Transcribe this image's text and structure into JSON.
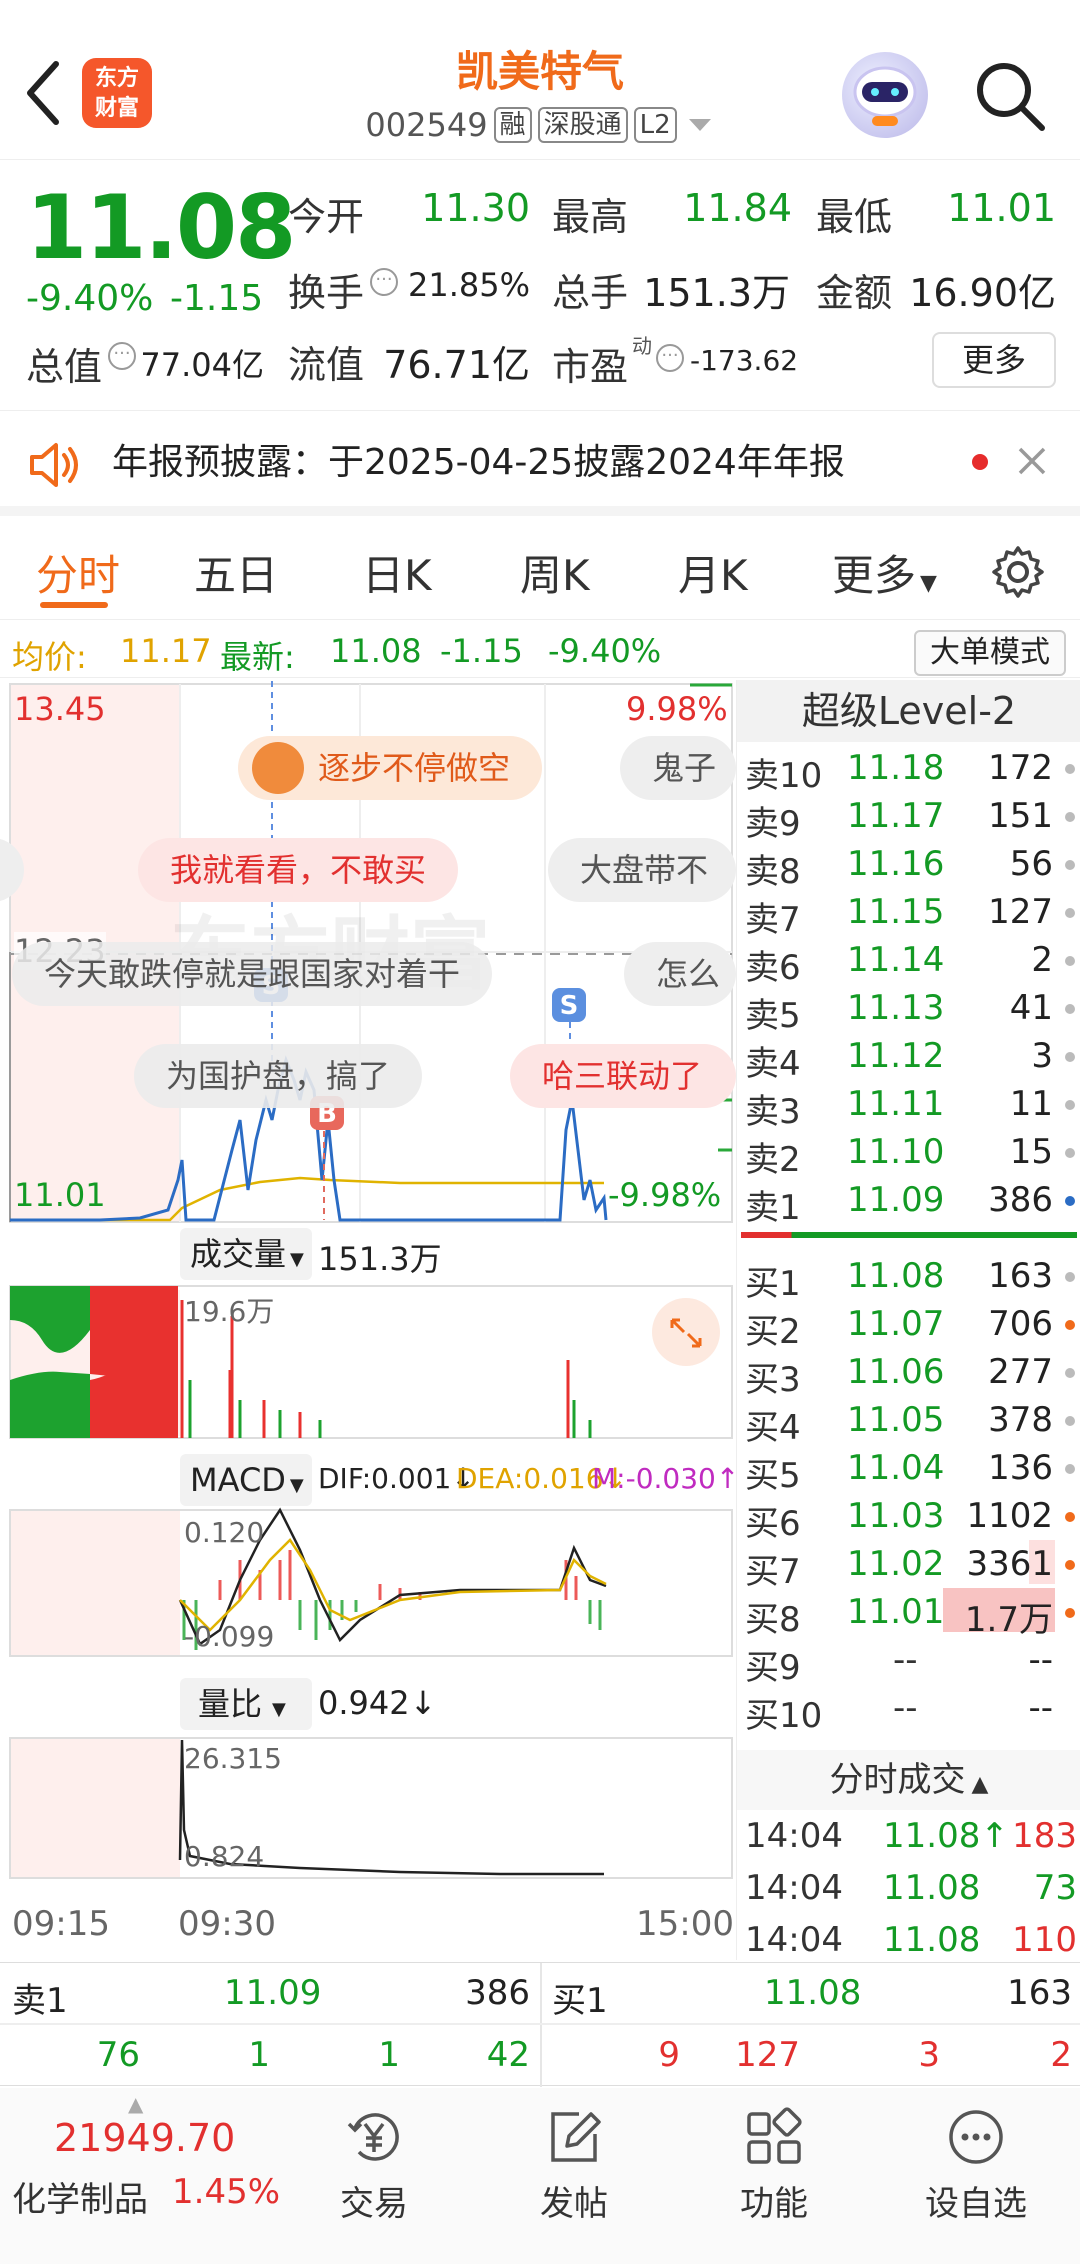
{
  "header": {
    "logo_line1": "东方",
    "logo_line2": "财富",
    "stock_name": "凯美特气",
    "stock_code": "002549",
    "tag_rong": "融",
    "tag_sgt": "深股通",
    "tag_l2": "L2"
  },
  "quote": {
    "price": "11.08",
    "change_pct": "-9.40%",
    "change_val": "-1.15",
    "open_label": "今开",
    "open": "11.30",
    "high_label": "最高",
    "high": "11.84",
    "low_label": "最低",
    "low": "11.01",
    "turnover_label": "换手",
    "turnover": "21.85%",
    "volume_label": "总手",
    "volume": "151.3万",
    "amount_label": "金额",
    "amount": "16.90亿",
    "mktcap_label": "总值",
    "mktcap": "77.04亿",
    "float_label": "流值",
    "float_cap": "76.71亿",
    "pe_label": "市盈",
    "pe_sup": "动",
    "pe": "-173.62",
    "more_label": "更多"
  },
  "notice": {
    "text": "年报预披露：于2025-04-25披露2024年年报"
  },
  "tabs": {
    "items": [
      "分时",
      "五日",
      "日K",
      "周K",
      "月K",
      "更多"
    ],
    "active": "分时"
  },
  "avg_bar": {
    "avg_label": "均价:",
    "avg": "11.17",
    "latest_label": "最新:",
    "latest": "11.08",
    "chg": "-1.15",
    "pct": "-9.40%",
    "bigorder_label": "大单模式"
  },
  "chart": {
    "high_price": "13.45",
    "high_pct": "9.98%",
    "low_price": "11.01",
    "low_pct": "-9.98%",
    "cross_price": "12.23",
    "watermark": "东方财富",
    "marker_s": "S",
    "marker_b": "B",
    "volume_label": "成交量",
    "volume_val": "151.3万",
    "volume_max": "19.6万",
    "macd_label": "MACD",
    "dif": "DIF:0.001↓",
    "dea": "DEA:0.016↓",
    "m": "M:-0.030↑",
    "macd_max": "0.120",
    "macd_min": "-0.099",
    "ratio_label": "量比",
    "ratio_val": "0.942↓",
    "ratio_max": "26.315",
    "ratio_min": "0.824",
    "time_start": "09:15",
    "time_open": "09:30",
    "time_end": "15:00",
    "colors": {
      "up": "#e2302f",
      "down": "#139a24",
      "price_line": "#2b6cc4",
      "avg_line": "#e0b300"
    }
  },
  "bubbles": [
    "逐步不停做空",
    "鬼子",
    "我就看看，不敢买",
    "大盘带不",
    "今天敢跌停就是跟国家对着干",
    "怎么",
    "为国护盘，搞了",
    "哈三联动了"
  ],
  "book": {
    "title": "超级Level-2",
    "asks": [
      {
        "label": "卖10",
        "price": "11.18",
        "vol": "172"
      },
      {
        "label": "卖9",
        "price": "11.17",
        "vol": "151"
      },
      {
        "label": "卖8",
        "price": "11.16",
        "vol": "56"
      },
      {
        "label": "卖7",
        "price": "11.15",
        "vol": "127"
      },
      {
        "label": "卖6",
        "price": "11.14",
        "vol": "2"
      },
      {
        "label": "卖5",
        "price": "11.13",
        "vol": "41"
      },
      {
        "label": "卖4",
        "price": "11.12",
        "vol": "3"
      },
      {
        "label": "卖3",
        "price": "11.11",
        "vol": "11"
      },
      {
        "label": "卖2",
        "price": "11.10",
        "vol": "15"
      },
      {
        "label": "卖1",
        "price": "11.09",
        "vol": "386"
      }
    ],
    "bids": [
      {
        "label": "买1",
        "price": "11.08",
        "vol": "163"
      },
      {
        "label": "买2",
        "price": "11.07",
        "vol": "706"
      },
      {
        "label": "买3",
        "price": "11.06",
        "vol": "277"
      },
      {
        "label": "买4",
        "price": "11.05",
        "vol": "378"
      },
      {
        "label": "买5",
        "price": "11.04",
        "vol": "136"
      },
      {
        "label": "买6",
        "price": "11.03",
        "vol": "1102"
      },
      {
        "label": "买7",
        "price": "11.02",
        "vol": "3361"
      },
      {
        "label": "买8",
        "price": "11.01",
        "vol": "1.7万"
      },
      {
        "label": "买9",
        "price": "--",
        "vol": "--"
      },
      {
        "label": "买10",
        "price": "--",
        "vol": "--"
      }
    ],
    "trades_title": "分时成交",
    "trades": [
      {
        "time": "14:04",
        "price": "11.08↑",
        "vol": "183"
      },
      {
        "time": "14:04",
        "price": "11.08",
        "vol": "73"
      },
      {
        "time": "14:04",
        "price": "11.08",
        "vol": "110"
      }
    ]
  },
  "level1": {
    "sell_label": "卖1",
    "sell_price": "11.09",
    "sell_vol": "386",
    "buy_label": "买1",
    "buy_price": "11.08",
    "buy_vol": "163",
    "sell_queue": [
      "76",
      "1",
      "1",
      "42"
    ],
    "buy_queue": [
      "9",
      "127",
      "3",
      "2"
    ]
  },
  "nav": {
    "index_value": "21949.70",
    "index_name": "化学制品",
    "index_pct": "1.45%",
    "items": [
      "交易",
      "发帖",
      "功能",
      "设自选"
    ]
  }
}
